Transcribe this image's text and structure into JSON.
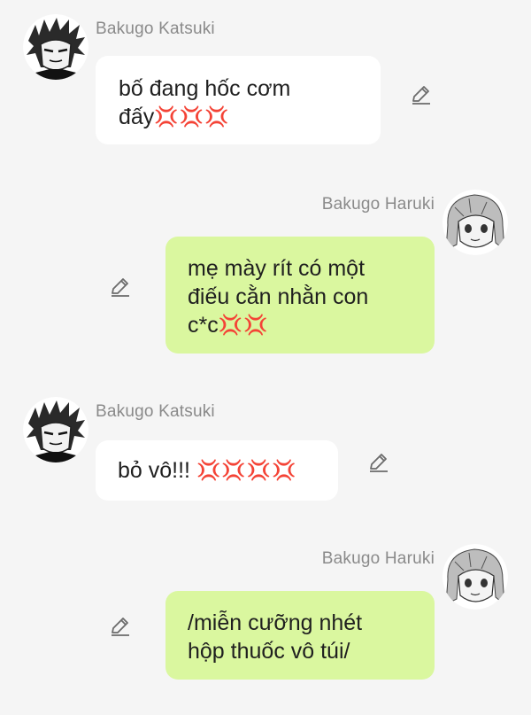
{
  "participants": {
    "katsuki": {
      "name": "Bakugo Katsuki",
      "avatar_icon": "anime-avatar-spiky-hair-icon"
    },
    "haruki": {
      "name": "Bakugo Haruki",
      "avatar_icon": "anime-avatar-girl-icon"
    }
  },
  "colors": {
    "background": "#f5f5f5",
    "left_bubble": "#ffffff",
    "right_bubble": "#daf79f",
    "name_text": "#8a8a8a",
    "anger_emoji": "#e0432f"
  },
  "messages": [
    {
      "sender": "Bakugo Katsuki",
      "side": "left",
      "text": "bố đang hốc cơm\nđấy",
      "emoji": "💢💢💢",
      "edit_icon": "pencil-icon"
    },
    {
      "sender": "Bakugo Haruki",
      "side": "right",
      "text": "mẹ mày rít có một\nđiếu cằn nhằn con\nc*c",
      "emoji": "💢💢",
      "edit_icon": "pencil-icon"
    },
    {
      "sender": "Bakugo Katsuki",
      "side": "left",
      "text": "bỏ vô!!! ",
      "emoji": "💢💢💢💢",
      "edit_icon": "pencil-icon"
    },
    {
      "sender": "Bakugo Haruki",
      "side": "right",
      "text": "/miễn cưỡng nhét\nhộp thuốc vô túi/",
      "emoji": "",
      "edit_icon": "pencil-icon"
    }
  ]
}
